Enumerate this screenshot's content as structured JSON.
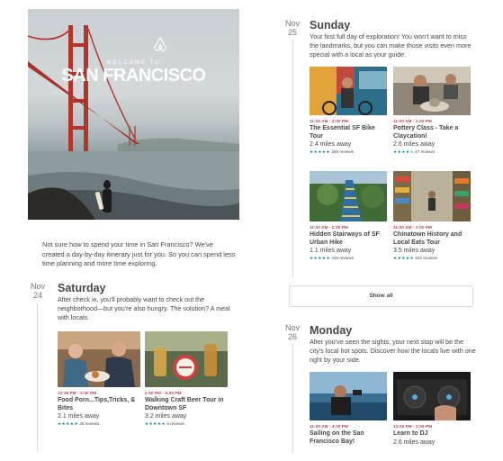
{
  "hero": {
    "welcome": "WELCOME TO",
    "city": "SAN FRANCISCO"
  },
  "intro": "Not sure how to spend your time in San Francisco? We've created a day-by-day itinerary just for you. So you can spend less time planning and more time exploring.",
  "days": {
    "saturday": {
      "month": "Nov",
      "date": "24",
      "title": "Saturday",
      "desc": "After check in, you'll probably want to check out the neighborhood—but you're also hungry. The solution? A meal with locals.",
      "cards": [
        {
          "time": "12:30 PM - 3:30 PM",
          "title": "Food Porn...Tips,Tricks, & Bites",
          "dist": "2.1 miles away",
          "stars": "★★★★★",
          "reviews": "26 reviews"
        },
        {
          "time": "2:00 PM - 6:00 PM",
          "title": "Walking Craft Beer Tour in Downtown SF",
          "dist": "3.2 miles away",
          "stars": "★★★★★",
          "reviews": "5 reviews"
        }
      ]
    },
    "sunday": {
      "month": "Nov",
      "date": "25",
      "title": "Sunday",
      "desc": "Your first full day of exploration! You won't want to miss the landmarks, but you can make those visits even more special with a local as your guide.",
      "cards": [
        {
          "time": "11:00 AM - 4:00 PM",
          "title": "The Essential SF Bike Tour",
          "dist": "2.4 miles away",
          "stars": "★★★★★",
          "reviews": "289 reviews"
        },
        {
          "time": "11:00 AM - 1:00 PM",
          "title": "Pottery Class - Take a Claycation!",
          "dist": "2.6 miles away",
          "stars": "★★★★½",
          "reviews": "47 reviews"
        },
        {
          "time": "11:00 AM - 2:00 PM",
          "title": "Hidden Stairways of SF Urban Hike",
          "dist": "1.1 miles away",
          "stars": "★★★★★",
          "reviews": "416 reviews"
        },
        {
          "time": "11:00 AM - 2:00 PM",
          "title": "Chinatown History and Local Eats Tour",
          "dist": "3.5 miles away",
          "stars": "★★★★★",
          "reviews": "101 reviews"
        }
      ],
      "show_all": "Show all"
    },
    "monday": {
      "month": "Nov",
      "date": "26",
      "title": "Monday",
      "desc": "After you've seen the sights, your next stop will be the city's local hot spots. Discover how the locals live with one right by your side.",
      "cards": [
        {
          "time": "11:00 AM - 4:00 PM",
          "title": "Sailing on the San Francisco Bay!"
        },
        {
          "time": "12:00 PM - 2:00 PM",
          "title": "Learn to DJ",
          "dist": "2.6 miles away"
        }
      ]
    }
  },
  "colors": {
    "accent": "#b4444a",
    "teal": "#008489",
    "text": "#484848"
  }
}
